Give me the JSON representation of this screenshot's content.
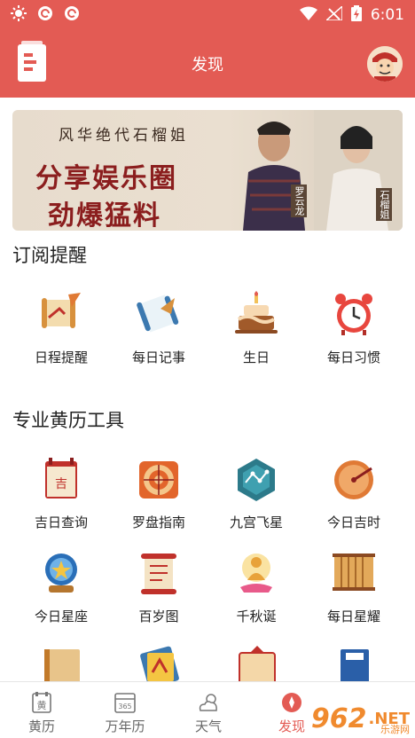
{
  "status_bar": {
    "time": "6:01",
    "icons": [
      "sun-icon",
      "app-icon",
      "app-icon",
      "wifi-icon",
      "signal-off-icon",
      "battery-charging-icon"
    ]
  },
  "header": {
    "title": "发现"
  },
  "banner": {
    "line1": "风华绝代石榴姐",
    "line2": "分享娱乐圈",
    "line3": "劲爆猛料",
    "tag_left": "罗云龙",
    "tag_right": "石榴姐"
  },
  "subscribe": {
    "title": "订阅提醒",
    "items": [
      {
        "label": "日程提醒",
        "icon": "scroll-quill-icon"
      },
      {
        "label": "每日记事",
        "icon": "scroll-note-icon"
      },
      {
        "label": "生日",
        "icon": "cake-icon"
      },
      {
        "label": "每日习惯",
        "icon": "alarm-clock-icon"
      }
    ]
  },
  "tools": {
    "title": "专业黄历工具",
    "items": [
      {
        "label": "吉日查询",
        "icon": "calendar-icon"
      },
      {
        "label": "罗盘指南",
        "icon": "compass-icon"
      },
      {
        "label": "九宫飞星",
        "icon": "hexagon-stars-icon"
      },
      {
        "label": "今日吉时",
        "icon": "sundial-icon"
      },
      {
        "label": "今日星座",
        "icon": "star-globe-icon"
      },
      {
        "label": "百岁图",
        "icon": "scroll-icon"
      },
      {
        "label": "千秋诞",
        "icon": "buddha-icon"
      },
      {
        "label": "每日星耀",
        "icon": "bamboo-slips-icon"
      }
    ]
  },
  "bottom_nav": [
    {
      "label": "黄历",
      "icon": "almanac-icon"
    },
    {
      "label": "万年历",
      "icon": "calendar-365-icon"
    },
    {
      "label": "天气",
      "icon": "weather-icon"
    },
    {
      "label": "发现",
      "icon": "discover-icon",
      "active": true
    }
  ],
  "watermark": {
    "number": "962",
    "suffix": ".NET",
    "sub": "乐游网"
  },
  "colors": {
    "brand_red": "#e35b54",
    "banner_red": "#8b1e1e"
  }
}
